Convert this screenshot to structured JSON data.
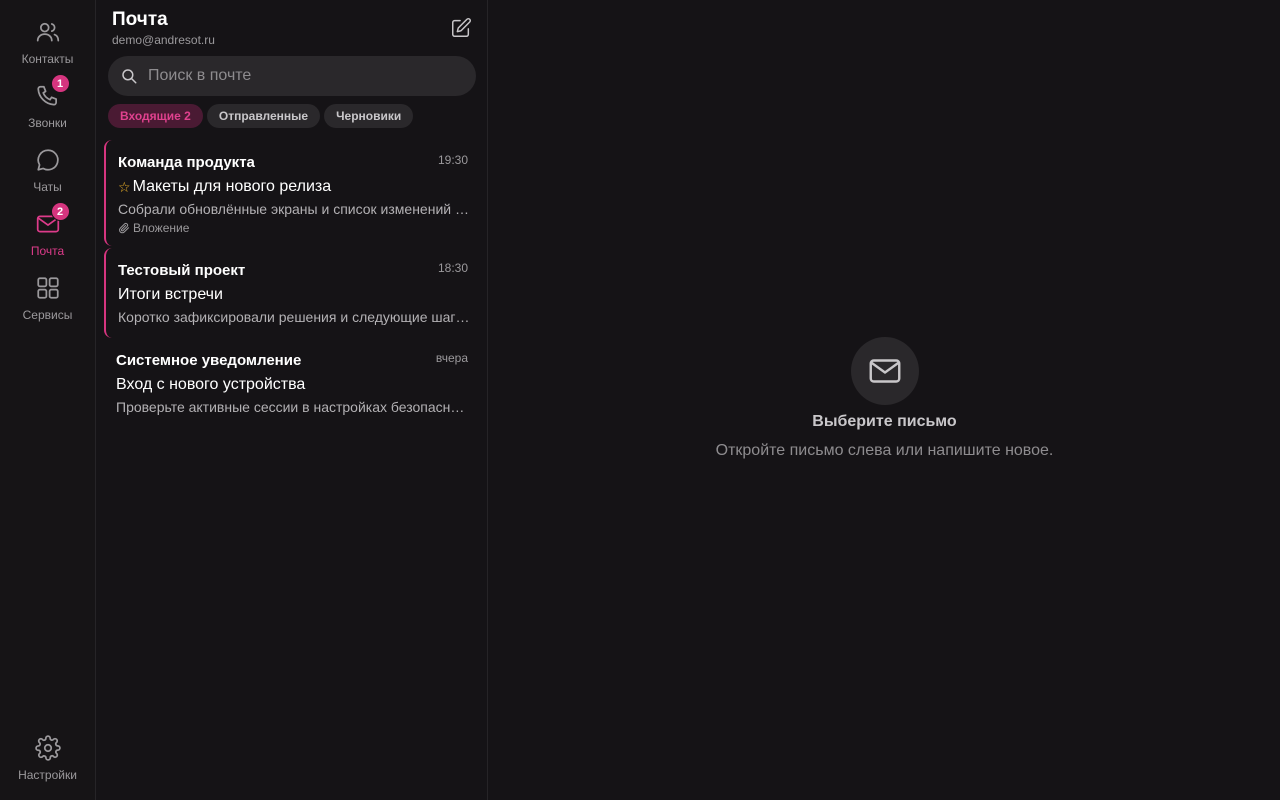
{
  "rail": {
    "items": [
      {
        "label": "Контакты",
        "icon": "users-icon"
      },
      {
        "label": "Звонки",
        "icon": "phone-icon",
        "badge": "1"
      },
      {
        "label": "Чаты",
        "icon": "chat-bubble-icon"
      },
      {
        "label": "Почта",
        "icon": "mail-icon",
        "badge": "2",
        "active": true
      },
      {
        "label": "Сервисы",
        "icon": "grid-icon"
      }
    ],
    "settings": {
      "label": "Настройки",
      "icon": "gear-icon"
    }
  },
  "mail": {
    "title": "Почта",
    "account": "demo@andresot.ru",
    "search_placeholder": "Поиск в почте",
    "folders": [
      {
        "label": "Входящие 2",
        "active": true
      },
      {
        "label": "Отправленные"
      },
      {
        "label": "Черновики"
      }
    ],
    "messages": [
      {
        "from": "Команда продукта",
        "time": "19:30",
        "subject": "Макеты для нового релиза",
        "starred": true,
        "preview": "Собрали обновлённые экраны и список изменений для проверки.",
        "attachment": "Вложение",
        "unread": true
      },
      {
        "from": "Тестовый проект",
        "time": "18:30",
        "subject": "Итоги встречи",
        "preview": "Коротко зафиксировали решения и следующие шаги по проекту.",
        "unread": true
      },
      {
        "from": "Системное уведомление",
        "time": "вчера",
        "subject": "Вход с нового устройства",
        "preview": "Проверьте активные сессии в настройках безопасности."
      }
    ]
  },
  "empty_state": {
    "icon": "envelope-icon",
    "title": "Выберите письмо",
    "subtitle": "Откройте письмо слева или напишите новое."
  },
  "colors": {
    "accent": "#d6357f",
    "background": "#151316",
    "surface": "#2a282b"
  }
}
